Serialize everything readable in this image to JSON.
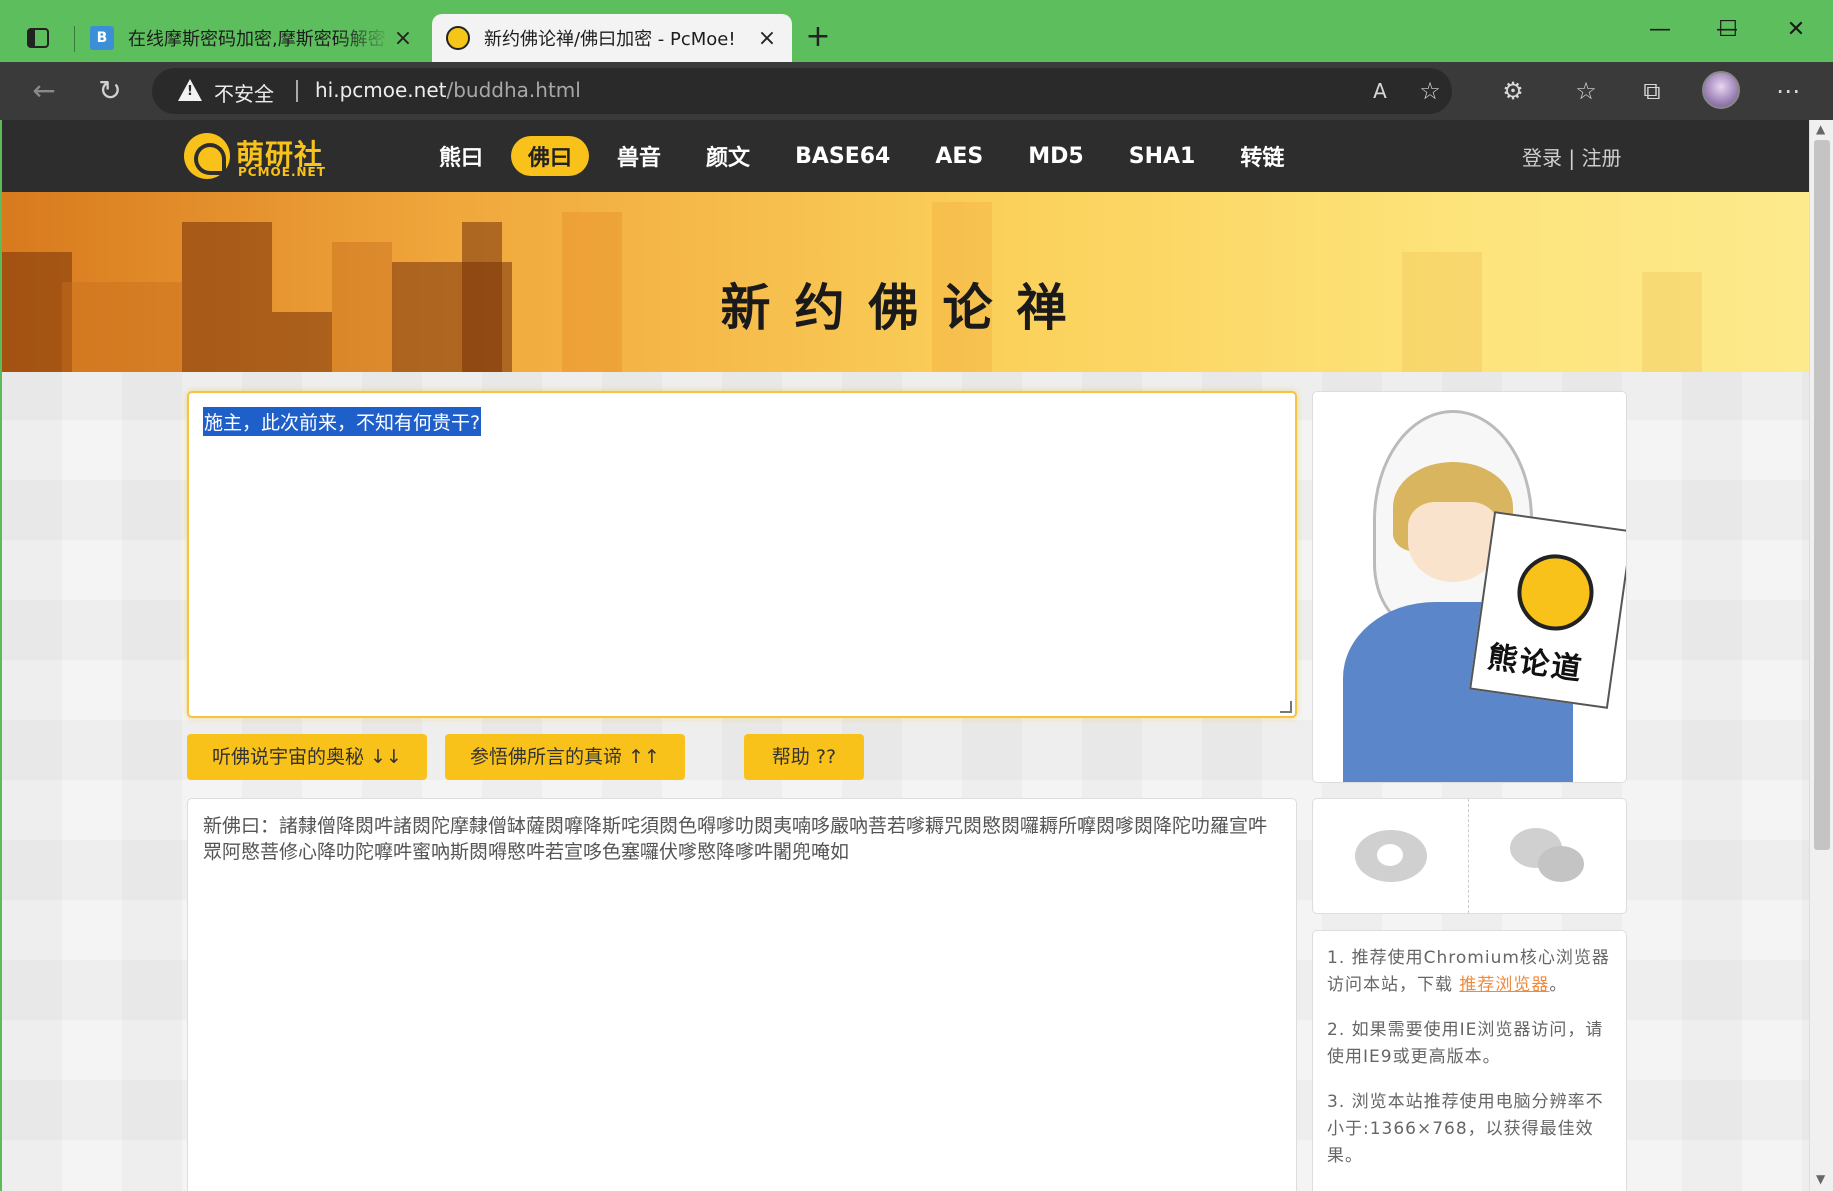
{
  "browser": {
    "tabs": [
      {
        "title": "在线摩斯密码加密,摩斯密码解密",
        "active": false
      },
      {
        "title": "新约佛论禅/佛曰加密 - PcMoe!",
        "active": true
      }
    ],
    "address": {
      "security_label": "不安全",
      "host": "hi.pcmoe.net",
      "path": "/buddha.html"
    }
  },
  "site": {
    "logo": {
      "cn": "萌研社",
      "en": "PCMOE.NET"
    },
    "menu": [
      {
        "label": "熊曰",
        "active": false
      },
      {
        "label": "佛曰",
        "active": true
      },
      {
        "label": "兽音",
        "active": false
      },
      {
        "label": "颜文",
        "active": false
      },
      {
        "label": "BASE64",
        "active": false
      },
      {
        "label": "AES",
        "active": false
      },
      {
        "label": "MD5",
        "active": false
      },
      {
        "label": "SHA1",
        "active": false
      },
      {
        "label": "转链",
        "active": false
      }
    ],
    "auth": {
      "login": "登录",
      "separator": "|",
      "register": "注册"
    },
    "banner_title": "新约佛论禅"
  },
  "main": {
    "input_text": "施主，此次前来，不知有何贵干?",
    "buttons": {
      "encode": "听佛说宇宙的奥秘 ↓↓",
      "decode": "参悟佛所言的真谛 ↑↑",
      "help": "帮助 ??"
    },
    "output_text": "新佛曰：諸隸僧降閦吽諸閦陀摩隸僧缽薩閦嚤降斯咤須閦色嘚嗲叻閦夷喃哆嚴吶菩若嗲耨咒閦愍閦囉耨所嚤閦嗲閦降陀叻羅宣吽眾阿愍菩修心降叻陀嚤吽蜜吶斯閦嘚愍吽若宣哆色塞囉伏嗲愍降嗲吽闍兜唵如"
  },
  "sidebar": {
    "poster_text": "熊论道",
    "tips": [
      {
        "text": "1. 推荐使用Chromium核心浏览器访问本站，下载 ",
        "link": "推荐浏览器",
        "after": "。"
      },
      {
        "text": "2. 如果需要使用IE浏览器访问，请使用IE9或更高版本。"
      },
      {
        "text": "3. 浏览本站推荐使用电脑分辨率不小于:1366×768，以获得最佳效果。"
      }
    ]
  }
}
